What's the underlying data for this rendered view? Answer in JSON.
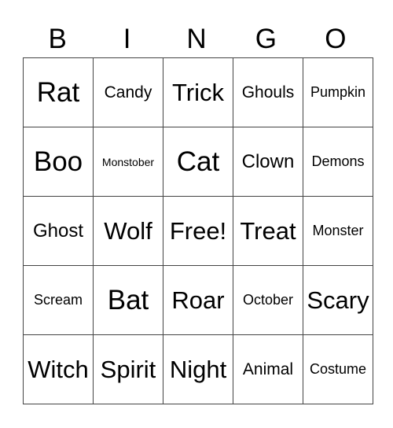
{
  "header": [
    "B",
    "I",
    "N",
    "G",
    "O"
  ],
  "rows": [
    [
      {
        "text": "Rat",
        "size": "s-xl"
      },
      {
        "text": "Candy",
        "size": "s-s"
      },
      {
        "text": "Trick",
        "size": "s-l"
      },
      {
        "text": "Ghouls",
        "size": "s-s"
      },
      {
        "text": "Pumpkin",
        "size": "s-xs"
      }
    ],
    [
      {
        "text": "Boo",
        "size": "s-xl"
      },
      {
        "text": "Monstober",
        "size": "s-xxs"
      },
      {
        "text": "Cat",
        "size": "s-xl"
      },
      {
        "text": "Clown",
        "size": "s-m"
      },
      {
        "text": "Demons",
        "size": "s-xs"
      }
    ],
    [
      {
        "text": "Ghost",
        "size": "s-m"
      },
      {
        "text": "Wolf",
        "size": "s-l"
      },
      {
        "text": "Free!",
        "size": "s-l"
      },
      {
        "text": "Treat",
        "size": "s-l"
      },
      {
        "text": "Monster",
        "size": "s-xs"
      }
    ],
    [
      {
        "text": "Scream",
        "size": "s-xs"
      },
      {
        "text": "Bat",
        "size": "s-xl"
      },
      {
        "text": "Roar",
        "size": "s-l"
      },
      {
        "text": "October",
        "size": "s-xs"
      },
      {
        "text": "Scary",
        "size": "s-l"
      }
    ],
    [
      {
        "text": "Witch",
        "size": "s-l"
      },
      {
        "text": "Spirit",
        "size": "s-l"
      },
      {
        "text": "Night",
        "size": "s-l"
      },
      {
        "text": "Animal",
        "size": "s-s"
      },
      {
        "text": "Costume",
        "size": "s-xs"
      }
    ]
  ]
}
